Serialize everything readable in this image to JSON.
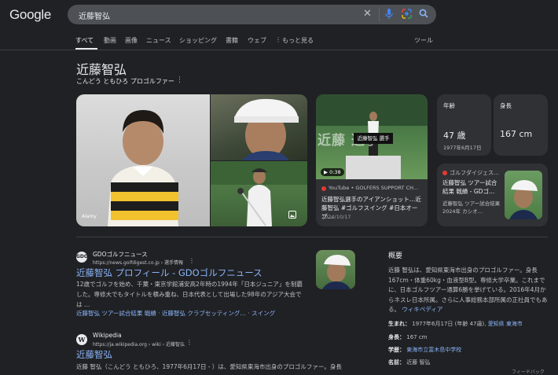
{
  "header": {
    "logo": "Google",
    "query": "近藤智弘",
    "tabs": [
      "すべて",
      "動画",
      "画像",
      "ニュース",
      "ショッピング",
      "書籍",
      "ウェブ",
      "もっと見る"
    ],
    "tools": "ツール"
  },
  "kp": {
    "title": "近藤智弘",
    "subtitle": "こんどう ともひろ プロゴルファー",
    "image_credit": "Alamy",
    "video": {
      "big_text": "近藤   選手",
      "label": "近藤智弘 選手",
      "duration": "0:38",
      "source": "YouTube • GOLFERS SUPPORT CH...",
      "title": "近藤智弘選手のアイアンショット…近藤智弘 #ゴルフスイング #日本オープ…",
      "date": "2024/10/17"
    },
    "age": {
      "label": "年齢",
      "value": "47 歳",
      "sub": "1977年6月17日"
    },
    "height": {
      "label": "身長",
      "value": "167 cm"
    },
    "news": {
      "source": "ゴルフダイジェス…",
      "title": "近藤智弘 ツアー試合結果 戦績 - GDゴ…",
      "snippet": "近藤智弘 ツアー試合結果 2024年 カシオ…"
    }
  },
  "results": [
    {
      "site": "GDOゴルフニュース",
      "url": "https://news.golfdigest.co.jp › 選手情報",
      "title": "近藤智弘 プロフィール - GDOゴルフニュース",
      "snippet": "12歳でゴルフを始め、千葉・東京学館浦安高2年時の1994年「日本ジュニア」を制覇した。専修大でもタイトルを積み重ね、日本代表として出場した98年のアジア大会では …",
      "links": [
        "近藤智弘 ツアー試合結果 戦績",
        "近藤智弘 クラブセッティング…",
        "スイング"
      ]
    },
    {
      "site": "Wikipedia",
      "url": "https://ja.wikipedia.org › wiki › 近藤智弘",
      "title": "近藤智弘",
      "snippet": "近藤 智弘（こんどう ともひろ、1977年6月17日 - ）は、愛知県東海市出身のプロゴルファー。身長"
    }
  ],
  "overview": {
    "title": "概要",
    "text": "近藤 智弘は、愛知県東海市出身のプロゴルファー。身長167cm・体重60kg・血液型B型。専修大学卒業。これまでに、日本ゴルフツアー通算6勝を挙げている。2016年4月からネスレ日本所属。さらに人事総務本部所属の正社員でもある。",
    "wiki_link": "ウィキペディア",
    "facts": [
      {
        "label": "生まれ：",
        "value": "1977年6月17日 (年齢 47歳), ",
        "link": "愛知県 東海市"
      },
      {
        "label": "身長：",
        "value": "167 cm",
        "link": ""
      },
      {
        "label": "学歴：",
        "value": "",
        "link": "東海市立富木島中学校"
      },
      {
        "label": "名前：",
        "value": "近藤 智弘",
        "link": ""
      }
    ],
    "feedback": "フィードバック"
  },
  "colors": {
    "background": "#202124",
    "link": "#8ab4f8",
    "card": "#303134",
    "text": "#e8eaed"
  }
}
